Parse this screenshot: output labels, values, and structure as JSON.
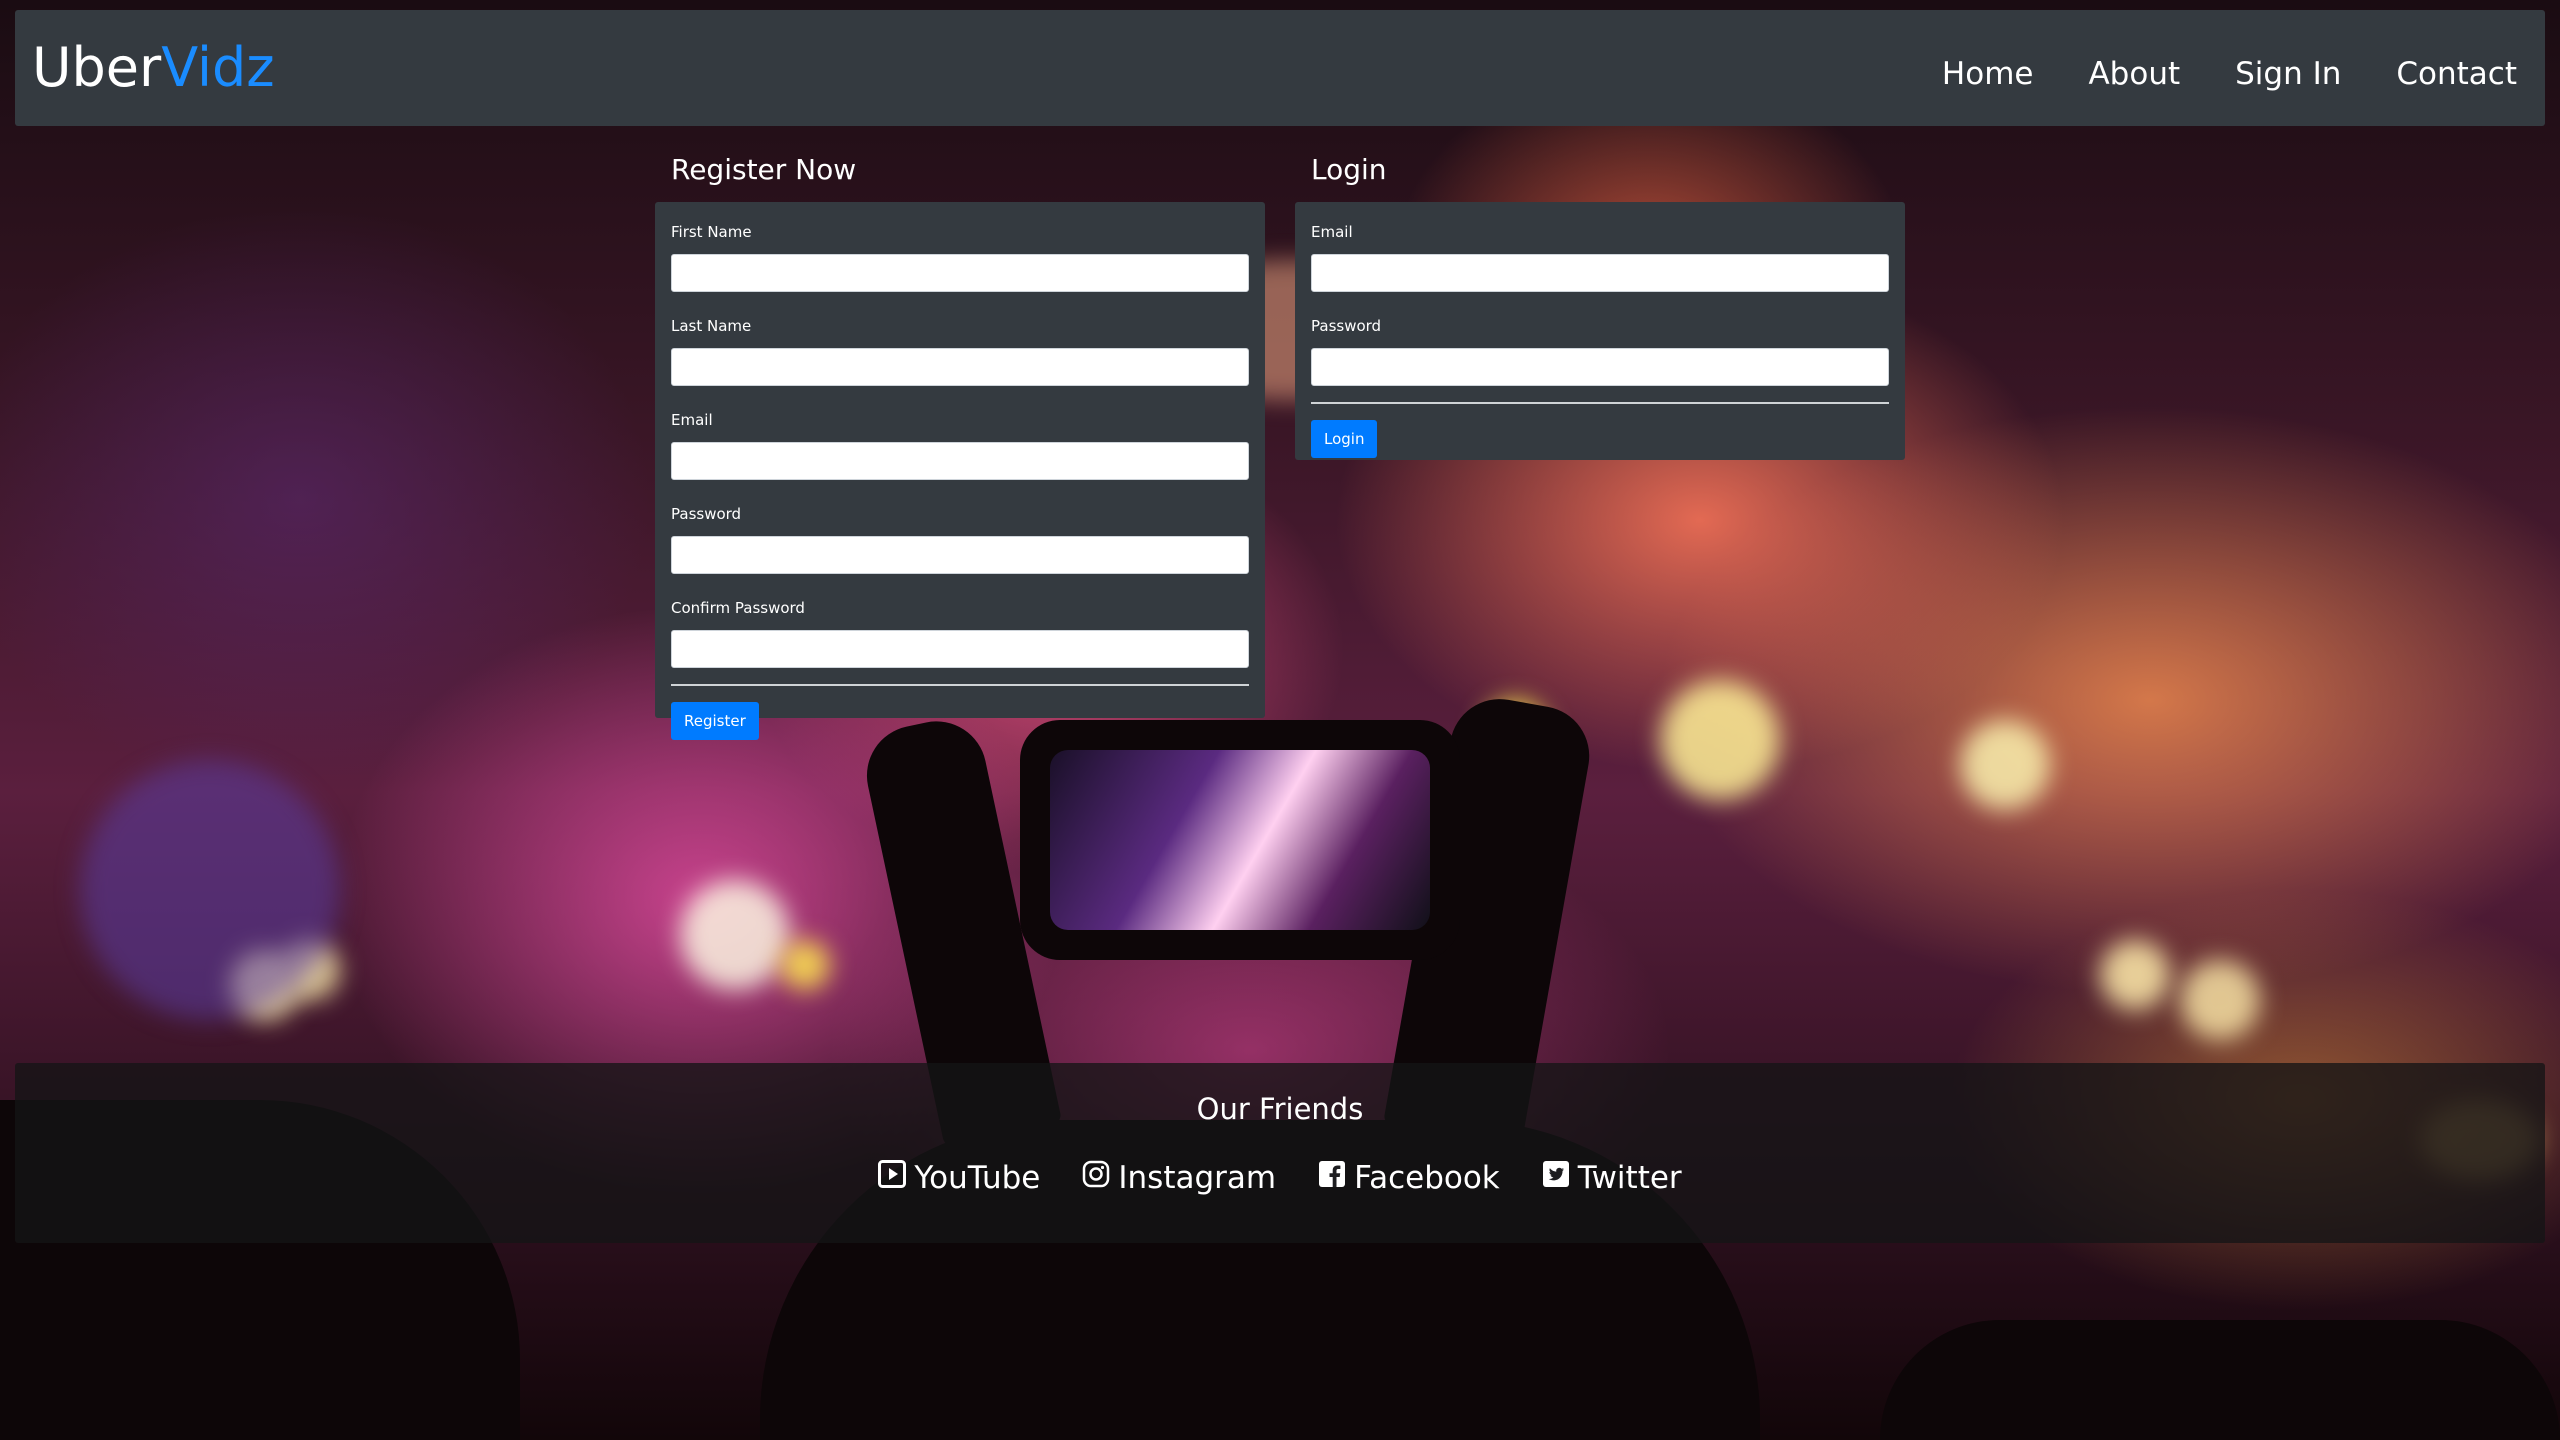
{
  "brand": {
    "name_part1": "Uber",
    "name_part2": "Vidz",
    "accent_color": "#1a8cff"
  },
  "nav": {
    "items": [
      {
        "label": "Home"
      },
      {
        "label": "About"
      },
      {
        "label": "Sign In"
      },
      {
        "label": "Contact"
      }
    ]
  },
  "register": {
    "title": "Register Now",
    "fields": [
      {
        "label": "First Name",
        "value": ""
      },
      {
        "label": "Last Name",
        "value": ""
      },
      {
        "label": "Email",
        "value": ""
      },
      {
        "label": "Password",
        "value": ""
      },
      {
        "label": "Confirm Password",
        "value": ""
      }
    ],
    "button_label": "Register"
  },
  "login": {
    "title": "Login",
    "fields": [
      {
        "label": "Email",
        "value": ""
      },
      {
        "label": "Password",
        "value": ""
      }
    ],
    "button_label": "Login"
  },
  "footer": {
    "title": "Our Friends",
    "links": [
      {
        "label": "YouTube",
        "icon": "youtube-icon"
      },
      {
        "label": "Instagram",
        "icon": "instagram-icon"
      },
      {
        "label": "Facebook",
        "icon": "facebook-icon"
      },
      {
        "label": "Twitter",
        "icon": "twitter-icon"
      }
    ]
  },
  "colors": {
    "navbar_bg": "#343a40",
    "panel_bg": "#343a40",
    "button_primary": "#007bff"
  }
}
